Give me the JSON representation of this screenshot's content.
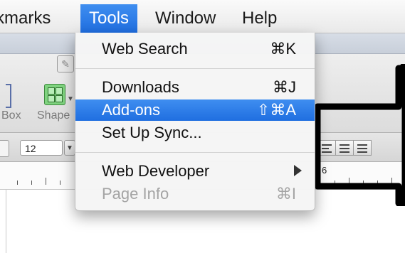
{
  "menubar": {
    "items": [
      {
        "label": "kmarks"
      },
      {
        "label": "Tools"
      },
      {
        "label": "Window"
      },
      {
        "label": "Help"
      }
    ]
  },
  "tools_menu": {
    "items": [
      {
        "label": "Web Search",
        "shortcut": "⌘K"
      },
      {
        "label": "Downloads",
        "shortcut": "⌘J"
      },
      {
        "label": "Add-ons",
        "shortcut": "⇧⌘A"
      },
      {
        "label": "Set Up Sync..."
      },
      {
        "label": "Web Developer"
      },
      {
        "label": "Page Info",
        "shortcut": "⌘I"
      }
    ]
  },
  "app": {
    "toolbar": {
      "box_label": "Box",
      "shape_label": "Shape"
    },
    "format_bar": {
      "font_size": "12"
    },
    "ruler": {
      "label_6": "6"
    }
  },
  "colors": {
    "highlight": "#2f7fe8",
    "annotation_arrow": "#000000"
  }
}
